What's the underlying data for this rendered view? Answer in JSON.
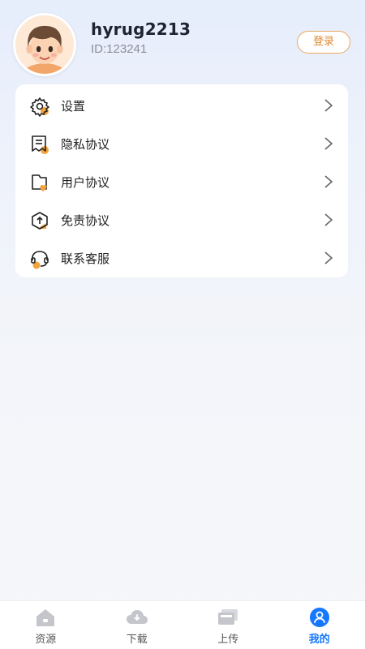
{
  "profile": {
    "username": "hyrug2213",
    "user_id": "ID:123241",
    "login_label": "登录"
  },
  "menu": {
    "items": [
      {
        "label": "设置",
        "icon": "gear-icon"
      },
      {
        "label": "隐私协议",
        "icon": "privacy-document-icon"
      },
      {
        "label": "用户协议",
        "icon": "user-agreement-folder-icon"
      },
      {
        "label": "免责协议",
        "icon": "disclaimer-box-icon"
      },
      {
        "label": "联系客服",
        "icon": "headset-icon"
      }
    ]
  },
  "tabbar": {
    "tabs": [
      {
        "label": "资源",
        "icon": "home-icon"
      },
      {
        "label": "下载",
        "icon": "cloud-download-icon"
      },
      {
        "label": "上传",
        "icon": "cards-upload-icon"
      },
      {
        "label": "我的",
        "icon": "user-profile-icon",
        "active": true
      }
    ]
  },
  "colors": {
    "accent": "#1677ff",
    "login_border": "#e8a862",
    "login_text": "#e08a33",
    "icon_orange": "#f2a33a"
  }
}
